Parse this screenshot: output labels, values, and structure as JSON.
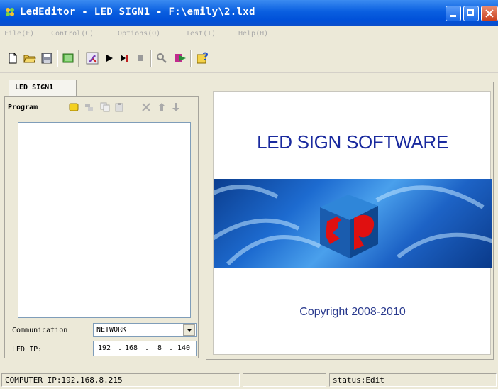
{
  "window": {
    "title": "LedEditor - LED SIGN1 - F:\\emily\\2.lxd"
  },
  "menu": {
    "items": [
      {
        "label": "File(F)"
      },
      {
        "label": "Control(C)"
      },
      {
        "label": "Options(O)"
      },
      {
        "label": "Test(T)"
      },
      {
        "label": "Help(H)"
      }
    ]
  },
  "toolbar": {
    "icons": [
      "new-file-icon",
      "open-folder-icon",
      "save-icon",
      "preview-icon",
      "edit-pen-icon",
      "play-icon",
      "step-play-icon",
      "stop-icon",
      "zoom-icon",
      "send-icon",
      "help-icon"
    ]
  },
  "tabs": [
    {
      "label": "LED SIGN1"
    }
  ],
  "program": {
    "label": "Program"
  },
  "communication": {
    "label": "Communication",
    "selected": "NETWORK"
  },
  "led_ip": {
    "label": "LED IP:",
    "octets": [
      "192",
      "168",
      "8",
      "140"
    ]
  },
  "splash": {
    "title": "LED SIGN SOFTWARE",
    "copyright": "Copyright 2008-2010"
  },
  "status": {
    "computer_ip": "COMPUTER IP:192.168.8.215",
    "middle": "",
    "state": "status:Edit"
  },
  "colors": {
    "titlebar": "#0a5fe0",
    "splash_text": "#1a2a9e",
    "banner": "#1d6bd0",
    "logo_red": "#e01010"
  }
}
